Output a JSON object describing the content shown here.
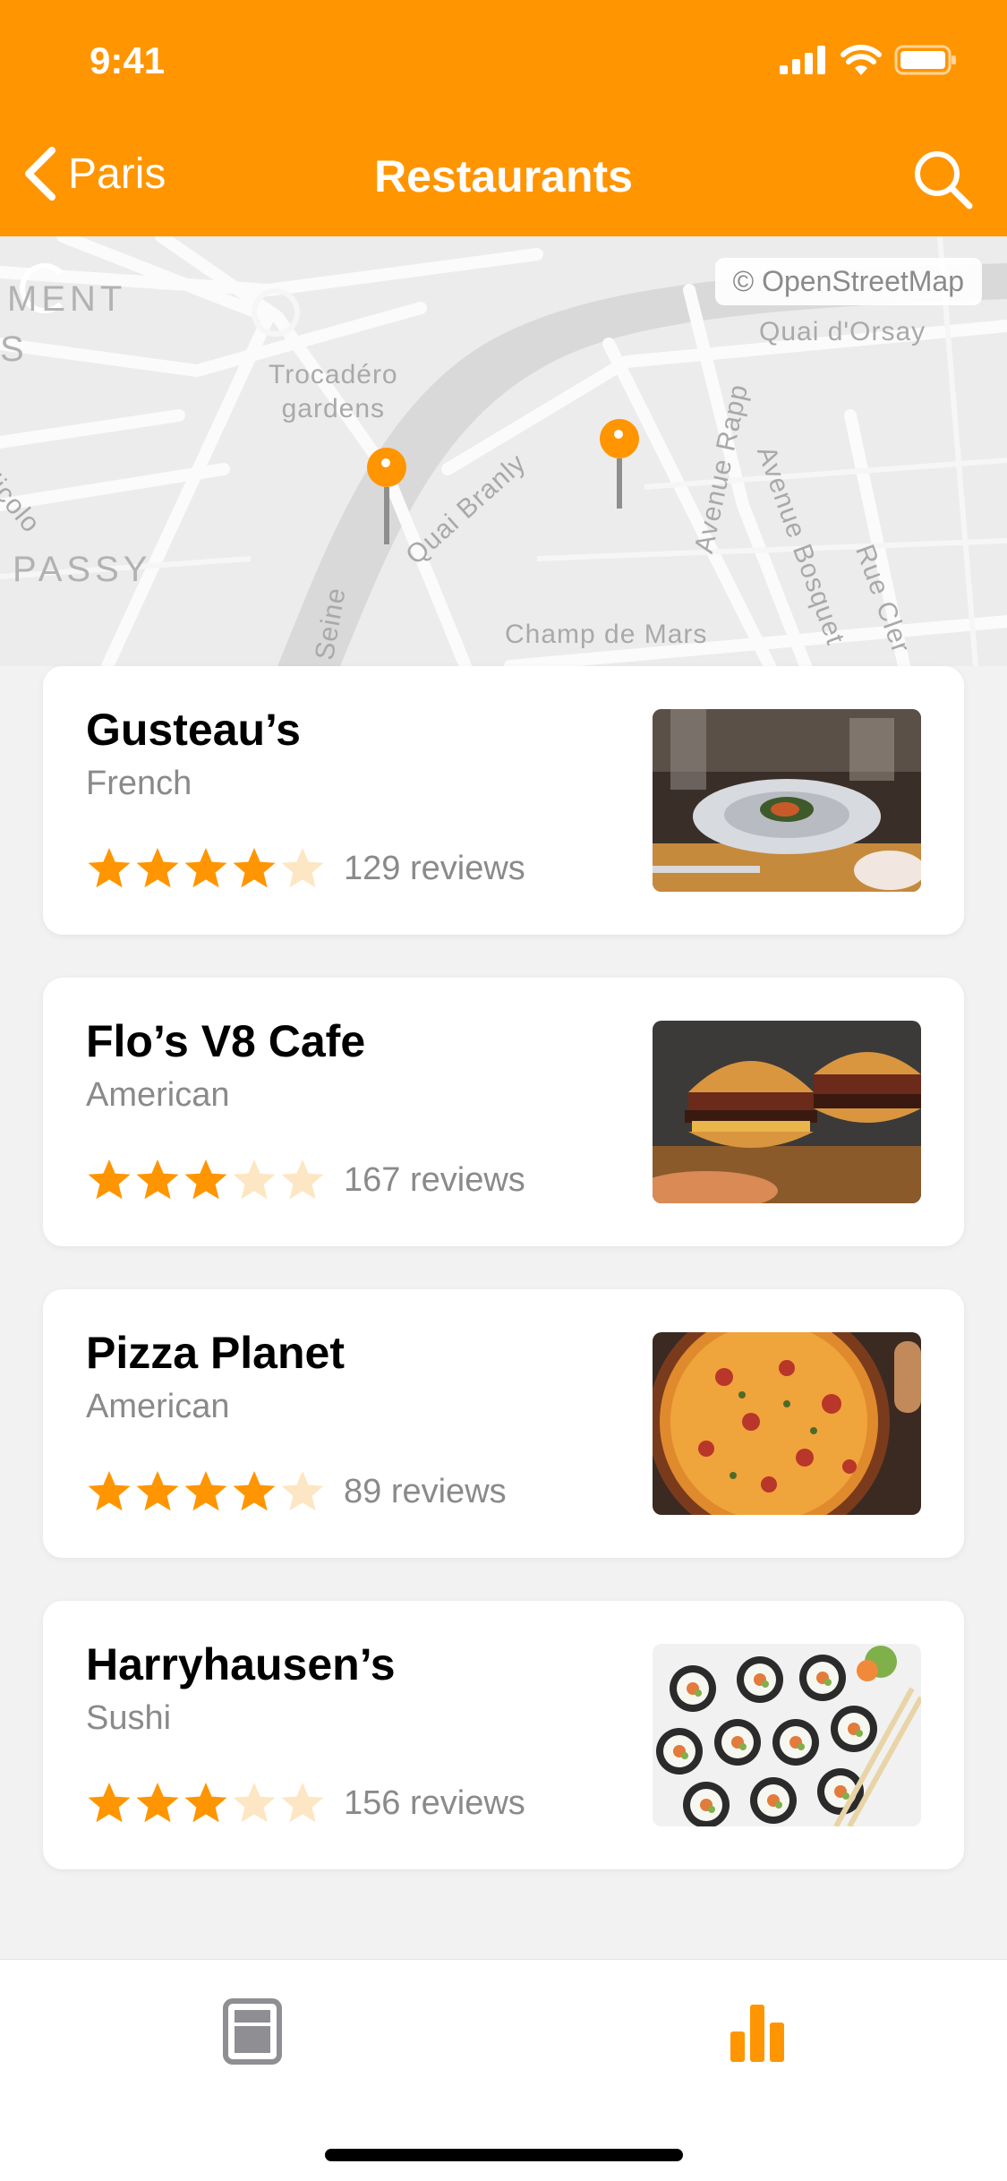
{
  "status_bar": {
    "time": "9:41"
  },
  "nav": {
    "back_label": "Paris",
    "title": "Restaurants"
  },
  "map": {
    "attribution": "© OpenStreetMap",
    "labels": {
      "ment": "MENT",
      "s": "S",
      "trocadero": "Trocadéro\ngardens",
      "nicolo": "Nicolo",
      "passy": "PASSY",
      "quai_branly": "Quai Branly",
      "avenue_rapp": "Avenue Rapp",
      "avenue_bosquet": "Avenue Bosquet",
      "quai_orsay": "Quai d'Orsay",
      "rue_cler": "Rue Cler",
      "champ_de_mars": "Champ de Mars",
      "seine": "Seine"
    }
  },
  "restaurants": [
    {
      "name": "Gusteau’s",
      "cuisine": "French",
      "rating": 4,
      "reviews": "129 reviews",
      "photo": "plated-dish"
    },
    {
      "name": "Flo’s V8 Cafe",
      "cuisine": "American",
      "rating": 3,
      "reviews": "167 reviews",
      "photo": "burgers"
    },
    {
      "name": "Pizza Planet",
      "cuisine": "American",
      "rating": 4,
      "reviews": "89 reviews",
      "photo": "pizza"
    },
    {
      "name": "Harryhausen’s",
      "cuisine": "Sushi",
      "rating": 3,
      "reviews": "156 reviews",
      "photo": "sushi"
    }
  ],
  "rating_max": 5,
  "colors": {
    "accent": "#ff9500",
    "star_empty": "#fde6c4",
    "secondary_text": "#8a8a8a"
  },
  "tabbar": {
    "tabs": [
      {
        "icon": "list-icon",
        "selected": false
      },
      {
        "icon": "bar-chart-icon",
        "selected": true
      }
    ]
  }
}
